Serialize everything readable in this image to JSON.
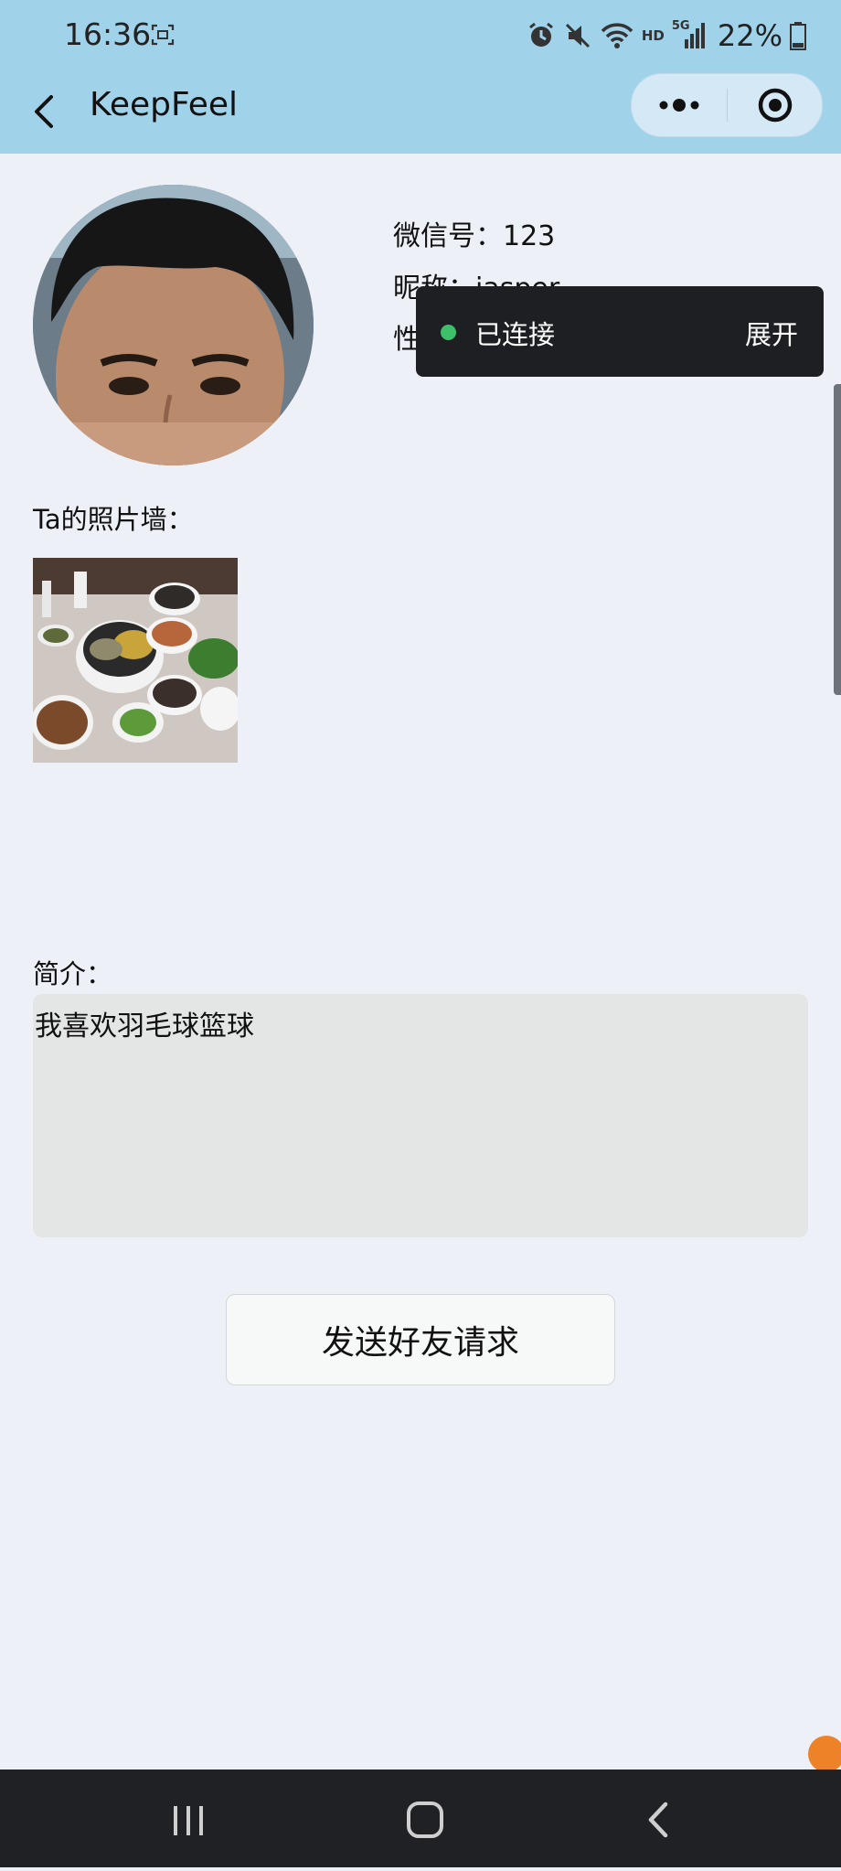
{
  "status_bar": {
    "time": "16:36",
    "battery": "22%",
    "icons": [
      "screen-record-icon",
      "alarm-icon",
      "mute-icon",
      "wifi-icon",
      "hd-icon",
      "5g-signal-icon",
      "battery-icon"
    ],
    "hd_label": "HD",
    "network_label": "5G"
  },
  "nav": {
    "title": "KeepFeel",
    "back_icon": "chevron-left-icon",
    "more_icon": "more-dots-icon",
    "close_icon": "target-circle-icon"
  },
  "profile": {
    "wechat_id": "微信号：123",
    "nickname": "昵称：jasper",
    "gender": "性别：男"
  },
  "toast": {
    "status": "已连接",
    "expand_label": "展开",
    "status_color": "#3ec06a"
  },
  "photo_wall": {
    "label": "Ta的照片墙："
  },
  "bio": {
    "label": "简介：",
    "text": "我喜欢羽毛球篮球"
  },
  "actions": {
    "send_request_label": "发送好友请求"
  },
  "system_nav": {
    "icons": [
      "recent-apps-icon",
      "home-icon",
      "back-icon"
    ]
  },
  "colors": {
    "header_bg": "#a0d2ea",
    "page_bg": "#edf1f7",
    "bio_box_bg": "#e4e5e5",
    "toast_bg": "#1e1f22",
    "system_nav_bg": "#202124"
  }
}
